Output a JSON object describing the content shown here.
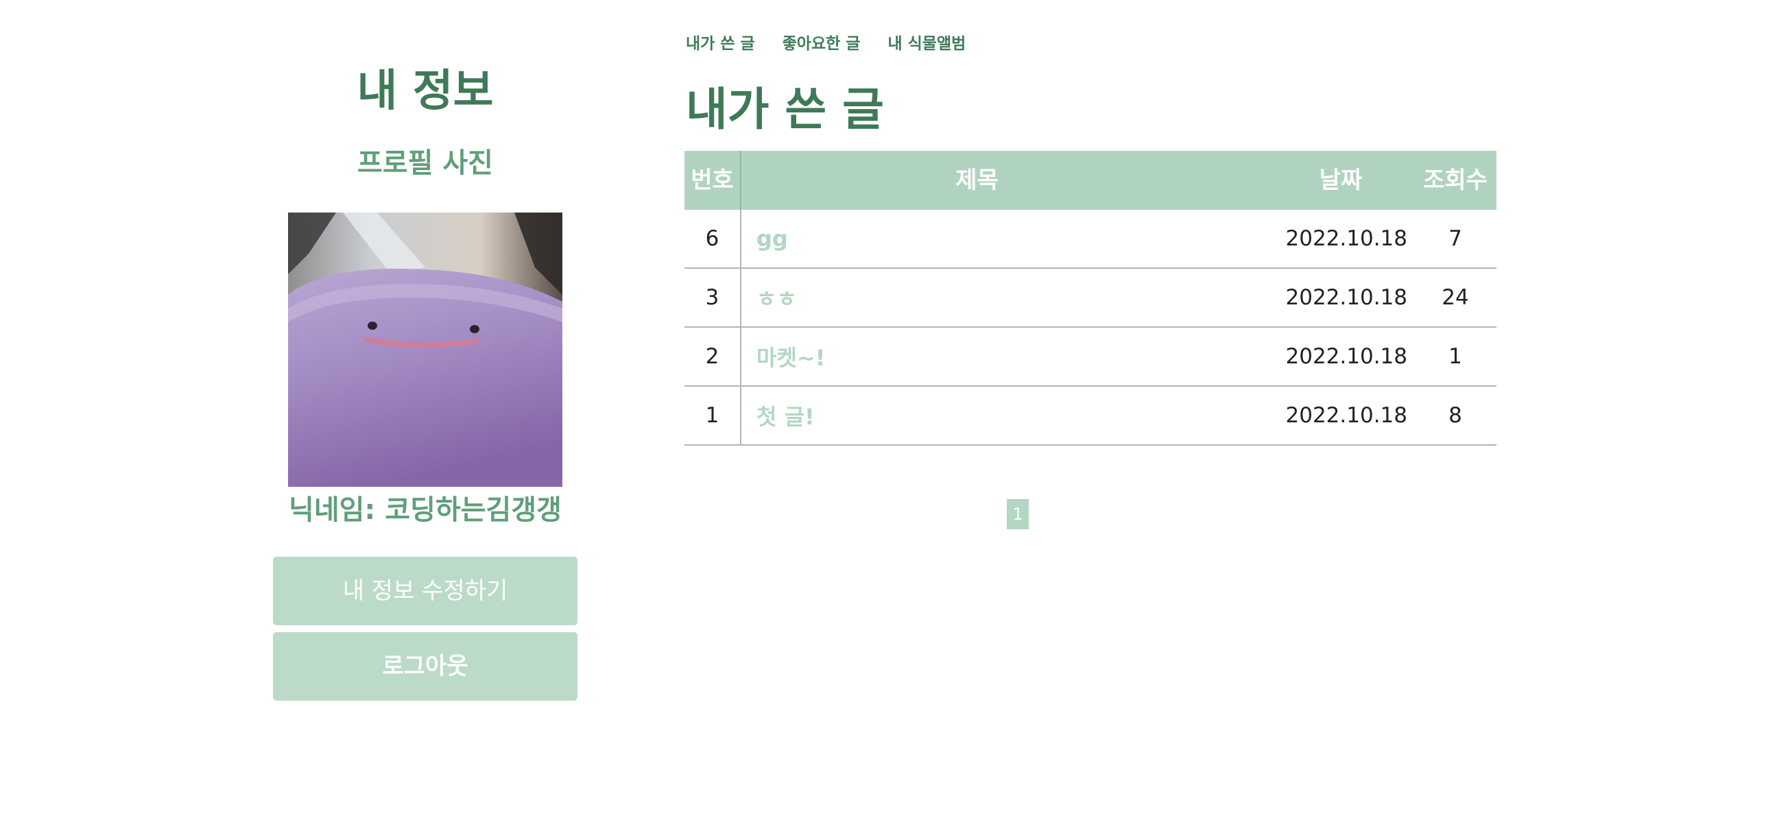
{
  "profile": {
    "title": "내 정보",
    "photo_label": "프로필 사진",
    "nickname": "닉네임: 코딩하는김갱갱",
    "edit_button": "내 정보 수정하기",
    "logout_button": "로그아웃"
  },
  "tabs": [
    {
      "label": "내가 쓴 글"
    },
    {
      "label": "좋아요한 글"
    },
    {
      "label": "내 식물앨범"
    }
  ],
  "section_title": "내가 쓴 글",
  "table": {
    "headers": {
      "num": "번호",
      "title": "제목",
      "date": "날짜",
      "views": "조회수"
    },
    "rows": [
      {
        "num": "6",
        "title": "gg",
        "date": "2022.10.18",
        "views": "7"
      },
      {
        "num": "3",
        "title": "ㅎㅎ",
        "date": "2022.10.18",
        "views": "24"
      },
      {
        "num": "2",
        "title": "마켓~!",
        "date": "2022.10.18",
        "views": "1"
      },
      {
        "num": "1",
        "title": "첫 글!",
        "date": "2022.10.18",
        "views": "8"
      }
    ]
  },
  "pagination": {
    "current_page": "1"
  },
  "colors": {
    "dark_green": "#3f7a57",
    "mid_green": "#5f9f79",
    "header_green": "#b0d3bf",
    "button_green": "#bbdbc8",
    "link_green": "#b3d7c2"
  }
}
